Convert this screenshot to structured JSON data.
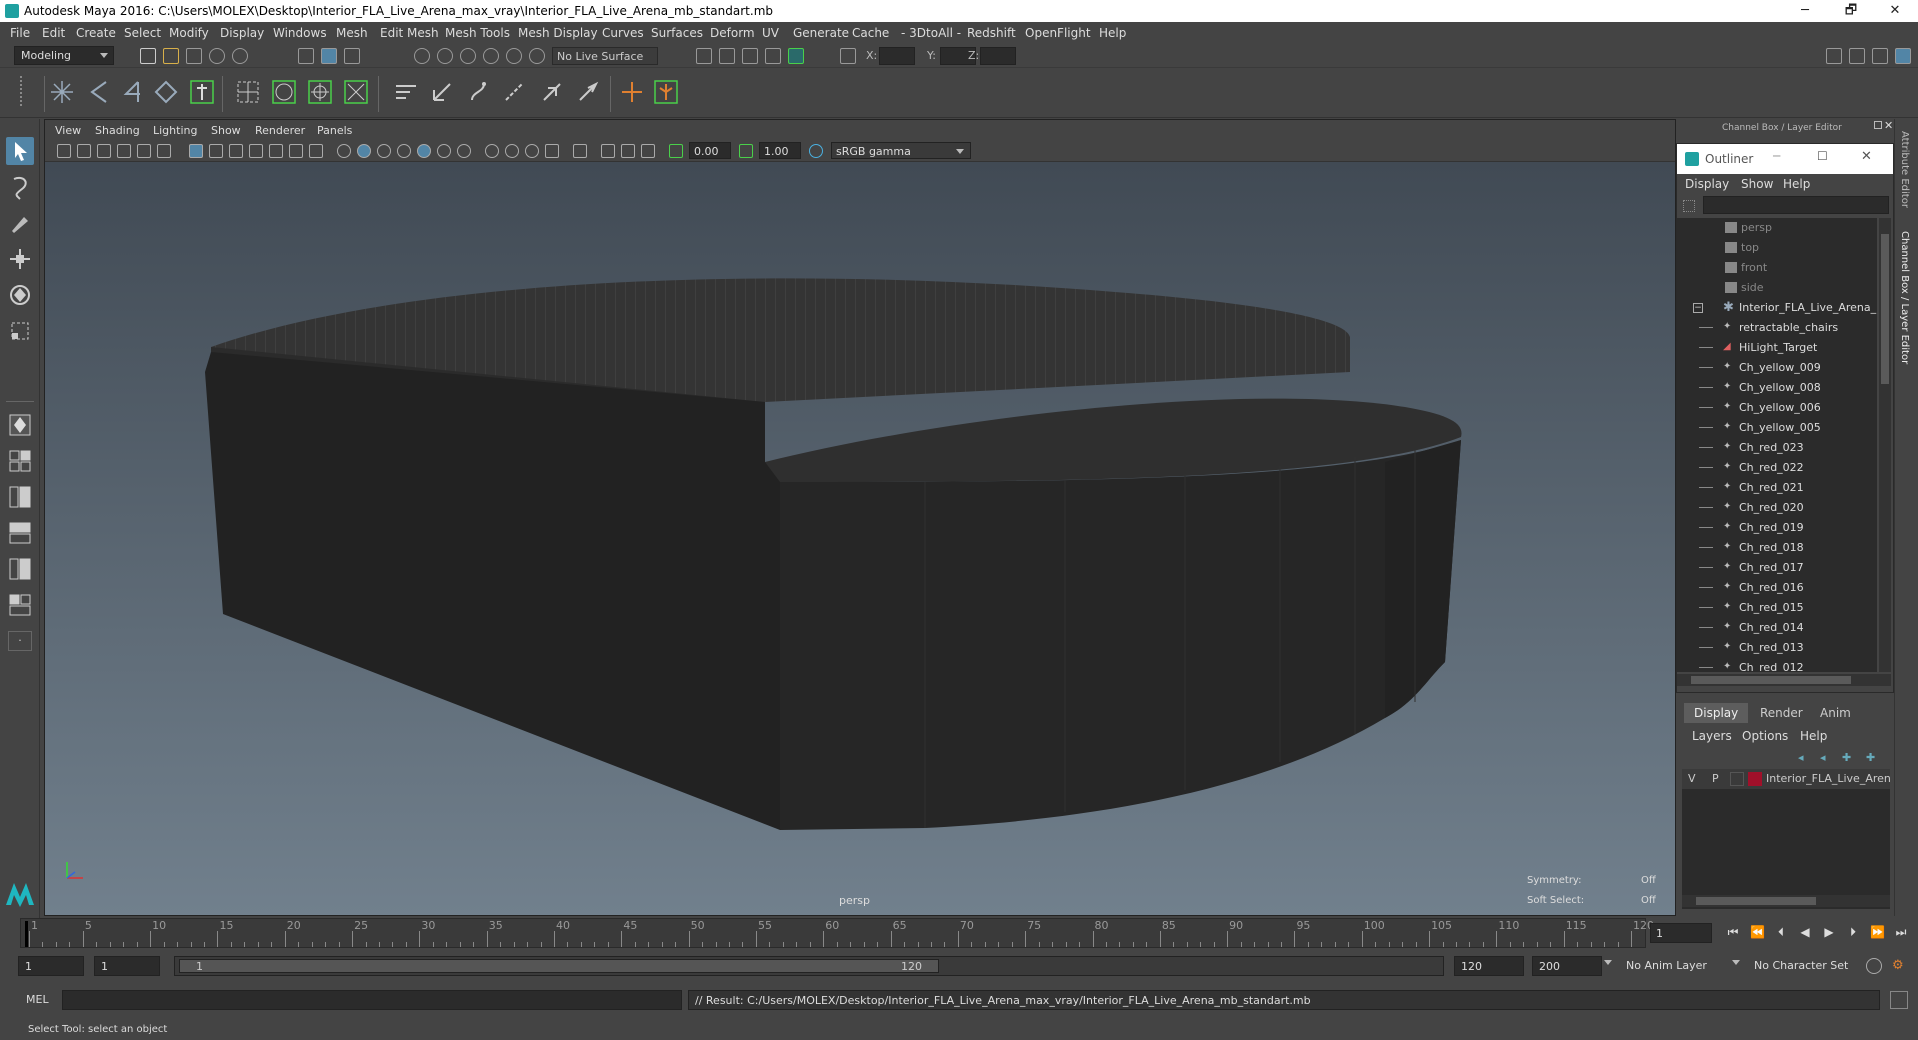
{
  "title_bar": {
    "title": "Autodesk Maya 2016: C:\\Users\\MOLEX\\Desktop\\Interior_FLA_Live_Arena_max_vray\\Interior_FLA_Live_Arena_mb_standart.mb",
    "minimize": "─",
    "maximize": "🗗",
    "close": "✕"
  },
  "menu": [
    "File",
    "Edit",
    "Create",
    "Select",
    "Modify",
    "Display",
    "Windows",
    "Mesh",
    "Edit Mesh",
    "Mesh Tools",
    "Mesh Display",
    "Curves",
    "Surfaces",
    "Deform",
    "UV",
    "Generate",
    "Cache",
    "- 3DtoAll -",
    "Redshift",
    "OpenFlight",
    "Help"
  ],
  "status_line": {
    "mode": "Modeling",
    "live_surface": "No Live Surface",
    "x_label": "X:",
    "y_label": "Y:",
    "z_label": "Z:"
  },
  "viewport": {
    "menu": [
      "View",
      "Shading",
      "Lighting",
      "Show",
      "Renderer",
      "Panels"
    ],
    "exposure": "0.00",
    "gamma": "1.00",
    "color_space": "sRGB gamma",
    "camera_label": "persp",
    "symmetry_label": "Symmetry:",
    "symmetry_value": "Off",
    "soft_select_label": "Soft Select:",
    "soft_select_value": "Off"
  },
  "right_panel": {
    "header": "Channel Box / Layer Editor",
    "outliner": {
      "title": "Outliner",
      "menu": [
        "Display",
        "Show",
        "Help"
      ],
      "cameras": [
        "persp",
        "top",
        "front",
        "side"
      ],
      "root": "Interior_FLA_Live_Arena_n",
      "children": [
        "retractable_chairs",
        "HiLight_Target",
        "Ch_yellow_009",
        "Ch_yellow_008",
        "Ch_yellow_006",
        "Ch_yellow_005",
        "Ch_red_023",
        "Ch_red_022",
        "Ch_red_021",
        "Ch_red_020",
        "Ch_red_019",
        "Ch_red_018",
        "Ch_red_017",
        "Ch_red_016",
        "Ch_red_015",
        "Ch_red_014",
        "Ch_red_013",
        "Ch_red_012"
      ]
    },
    "layer_editor": {
      "tabs": [
        "Display",
        "Render",
        "Anim"
      ],
      "menu": [
        "Layers",
        "Options",
        "Help"
      ],
      "layer": {
        "v": "V",
        "p": "P",
        "name": "Interior_FLA_Live_Aren",
        "color": "#a0102a"
      }
    },
    "vertical_tabs": [
      "Attribute Editor",
      "Channel Box / Layer Editor"
    ]
  },
  "time_slider": {
    "ticks": [
      1,
      5,
      10,
      15,
      20,
      25,
      30,
      35,
      40,
      45,
      50,
      55,
      60,
      65,
      70,
      75,
      80,
      85,
      90,
      95,
      100,
      105,
      110,
      115,
      120
    ],
    "current_frame": "1"
  },
  "range_slider": {
    "start": "1",
    "start2": "1",
    "range_start": "1",
    "range_end": "120",
    "end": "120",
    "end2": "200",
    "anim_layer": "No Anim Layer",
    "char_set": "No Character Set"
  },
  "command_line": {
    "label": "MEL",
    "result": "// Result: C:/Users/MOLEX/Desktop/Interior_FLA_Live_Arena_max_vray/Interior_FLA_Live_Arena_mb_standart.mb"
  },
  "help_line": "Select Tool: select an object"
}
